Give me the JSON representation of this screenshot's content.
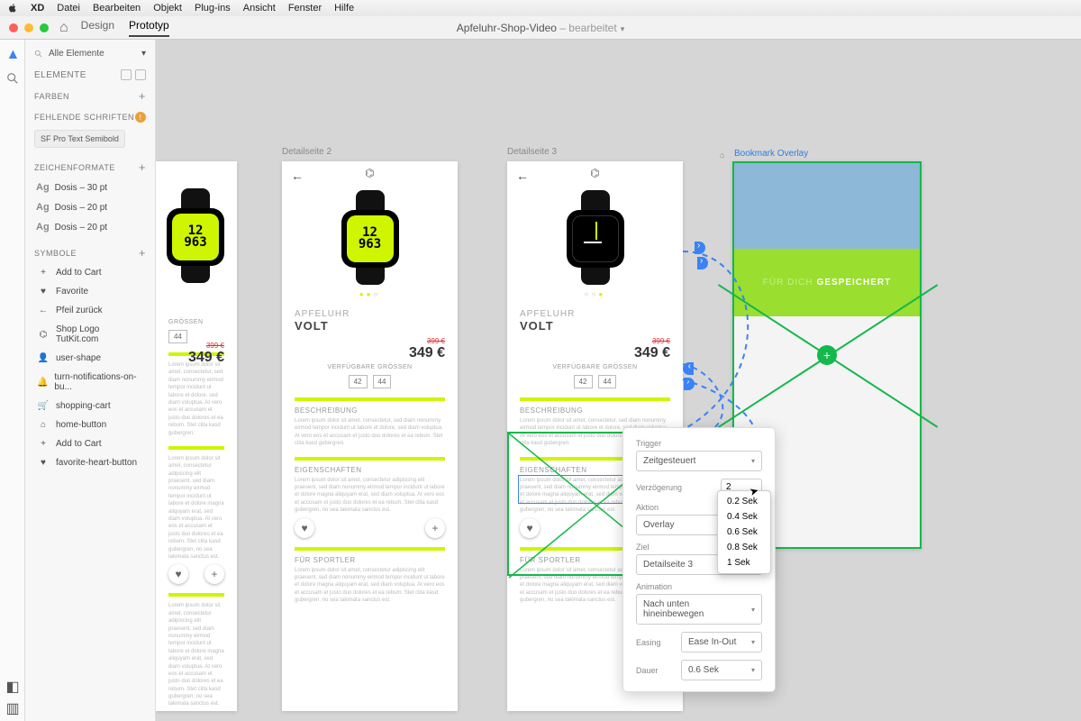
{
  "menubar": {
    "app": "XD",
    "items": [
      "Datei",
      "Bearbeiten",
      "Objekt",
      "Plug-ins",
      "Ansicht",
      "Fenster",
      "Hilfe"
    ]
  },
  "toolbar": {
    "design": "Design",
    "prototyp": "Prototyp",
    "doc_name": "Apfeluhr-Shop-Video",
    "edited": " – bearbeitet"
  },
  "assets": {
    "filter_label": "Alle Elemente",
    "section_elements": "ELEMENTE",
    "colors": "Farben",
    "missing_fonts": "Fehlende Schriften",
    "missing_font_item": "SF Pro Text Semibold",
    "char_styles": "Zeichenformate",
    "styles": [
      "Dosis – 30 pt",
      "Dosis – 20 pt",
      "Dosis – 20 pt"
    ],
    "symbols": "Symbole",
    "symbol_items": [
      {
        "g": "+",
        "t": "Add to Cart"
      },
      {
        "g": "♥",
        "t": "Favorite"
      },
      {
        "g": "←",
        "t": "Pfeil zurück"
      },
      {
        "g": "⌬",
        "t": "Shop Logo TutKit.com"
      },
      {
        "g": "👤",
        "t": "user-shape"
      },
      {
        "g": "🔔",
        "t": "turn-notifications-on-bu..."
      },
      {
        "g": "🛒",
        "t": "shopping-cart"
      },
      {
        "g": "⌂",
        "t": "home-button"
      },
      {
        "g": "+",
        "t": "Add to Cart"
      },
      {
        "g": "♥",
        "t": "favorite-heart-button"
      }
    ]
  },
  "artboards": {
    "detail2_label": "Detailseite 2",
    "detail3_label": "Detailseite 3",
    "bookmark_label": "Bookmark Overlay"
  },
  "product": {
    "brand": "APFELUHR",
    "variant": "VOLT",
    "price_old": "399 €",
    "price_new": "349 €",
    "sizes_label": "VERFÜGBARE GRÖSSEN",
    "sizes": [
      "42",
      "44"
    ],
    "sec1": "BESCHREIBUNG",
    "sec2": "EIGENSCHAFTEN",
    "sec3": "FÜR SPORTLER",
    "lorem1": "Lorem ipsum dolor sit amet, consectetur, sed diam nonummy eirmod tempor incidunt ut labore et dolore, sed diam voluptua. At vero eos et accusam et justo duo dolores et ea rebum. Stet clita kasd gubergren.",
    "lorem2": "Lorem ipsum dolor sit amet, consectetur adipiscing elit praesent, sed diam nonummy eirmod tempor incidunt ut labore et dolore magna aliquyam erat, sed diam voluptua. At vero eos et accusam et justo duo dolores et ea rebum. Stet clita kasd gubergren, no sea takimata sanctus est."
  },
  "overlay": {
    "word1": "FÜR DICH",
    "word2": "GESPEICHERT"
  },
  "proto": {
    "trigger_lbl": "Trigger",
    "trigger_val": "Zeitgesteuert",
    "delay_lbl": "Verzögerung",
    "delay_val": "2",
    "action_lbl": "Aktion",
    "action_val": "Overlay",
    "target_lbl": "Ziel",
    "target_val": "Detailseite 3",
    "anim_lbl": "Animation",
    "anim_val": "Nach unten hineinbewegen",
    "easing_lbl": "Easing",
    "easing_val": "Ease In-Out",
    "dur_lbl": "Dauer",
    "dur_val": "0.6 Sek"
  },
  "delay_options": [
    "0.2 Sek",
    "0.4 Sek",
    "0.6 Sek",
    "0.8 Sek",
    "1 Sek"
  ],
  "sizes_label2": "GRÖSSEN"
}
